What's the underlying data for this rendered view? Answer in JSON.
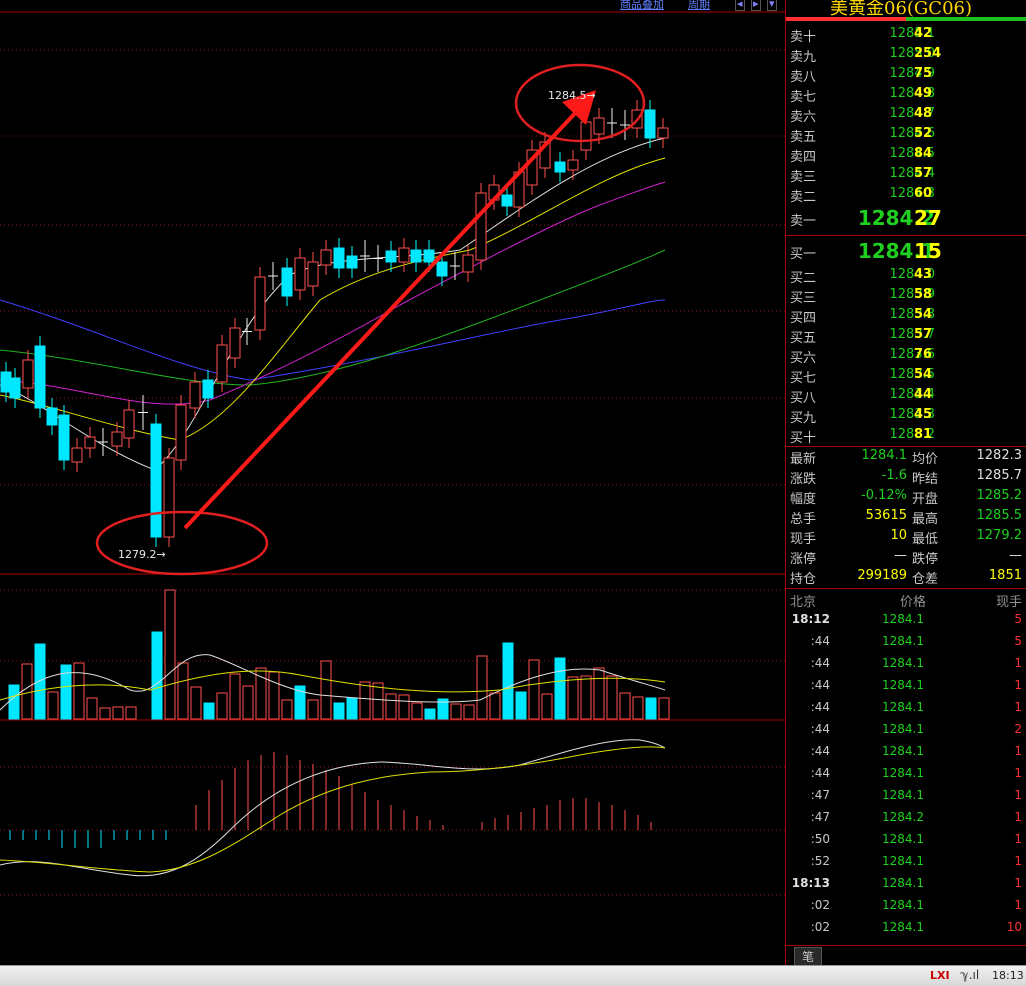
{
  "toolbar": {
    "link_overlay": "商品叠加",
    "link_cycle": "周期",
    "nav_prev": "◂",
    "nav_next": "▸",
    "nav_menu": "▾"
  },
  "chart": {
    "low_label": "1279.2→",
    "high_label": "1284.5→"
  },
  "panel": {
    "title": "美黄金06(GC06)",
    "sell": [
      {
        "label": "卖十",
        "price": "1285.1",
        "qty": "42"
      },
      {
        "label": "卖九",
        "price": "1285.0",
        "qty": "254"
      },
      {
        "label": "卖八",
        "price": "1284.9",
        "qty": "75"
      },
      {
        "label": "卖七",
        "price": "1284.8",
        "qty": "49"
      },
      {
        "label": "卖六",
        "price": "1284.7",
        "qty": "48"
      },
      {
        "label": "卖五",
        "price": "1284.6",
        "qty": "52"
      },
      {
        "label": "卖四",
        "price": "1284.5",
        "qty": "84"
      },
      {
        "label": "卖三",
        "price": "1284.4",
        "qty": "57"
      },
      {
        "label": "卖二",
        "price": "1284.3",
        "qty": "60"
      },
      {
        "label": "卖一",
        "price": "1284.2",
        "qty": "27"
      }
    ],
    "buy": [
      {
        "label": "买一",
        "price": "1284.1",
        "qty": "15"
      },
      {
        "label": "买二",
        "price": "1284.0",
        "qty": "43"
      },
      {
        "label": "买三",
        "price": "1283.9",
        "qty": "58"
      },
      {
        "label": "买四",
        "price": "1283.8",
        "qty": "54"
      },
      {
        "label": "买五",
        "price": "1283.7",
        "qty": "57"
      },
      {
        "label": "买六",
        "price": "1283.6",
        "qty": "76"
      },
      {
        "label": "买七",
        "price": "1283.5",
        "qty": "54"
      },
      {
        "label": "买八",
        "price": "1283.4",
        "qty": "44"
      },
      {
        "label": "买九",
        "price": "1283.3",
        "qty": "45"
      },
      {
        "label": "买十",
        "price": "1283.2",
        "qty": "81"
      }
    ],
    "quote": [
      {
        "k1": "最新",
        "v1": "1284.1",
        "c1": "g",
        "k2": "均价",
        "v2": "1282.3",
        "c2": "w"
      },
      {
        "k1": "涨跌",
        "v1": "-1.6",
        "c1": "g",
        "k2": "昨结",
        "v2": "1285.7",
        "c2": "w"
      },
      {
        "k1": "幅度",
        "v1": "-0.12%",
        "c1": "g",
        "k2": "开盘",
        "v2": "1285.2",
        "c2": "g"
      },
      {
        "k1": "总手",
        "v1": "53615",
        "c1": "y",
        "k2": "最高",
        "v2": "1285.5",
        "c2": "g"
      },
      {
        "k1": "现手",
        "v1": "10",
        "c1": "y",
        "k2": "最低",
        "v2": "1279.2",
        "c2": "g"
      },
      {
        "k1": "涨停",
        "v1": "—",
        "c1": "w",
        "k2": "跌停",
        "v2": "—",
        "c2": "w"
      },
      {
        "k1": "持仓",
        "v1": "299189",
        "c1": "y",
        "k2": "仓差",
        "v2": "1851",
        "c2": "y"
      }
    ],
    "ticks_header": {
      "time": "北京",
      "price": "价格",
      "vol": "现手"
    },
    "ticks": [
      {
        "time": "18:12",
        "price": "1284.1",
        "vol": "5"
      },
      {
        "time": ":44",
        "price": "1284.1",
        "vol": "5"
      },
      {
        "time": ":44",
        "price": "1284.1",
        "vol": "1"
      },
      {
        "time": ":44",
        "price": "1284.1",
        "vol": "1"
      },
      {
        "time": ":44",
        "price": "1284.1",
        "vol": "1"
      },
      {
        "time": ":44",
        "price": "1284.1",
        "vol": "2"
      },
      {
        "time": ":44",
        "price": "1284.1",
        "vol": "1"
      },
      {
        "time": ":44",
        "price": "1284.1",
        "vol": "1"
      },
      {
        "time": ":47",
        "price": "1284.1",
        "vol": "1"
      },
      {
        "time": ":47",
        "price": "1284.2",
        "vol": "1"
      },
      {
        "time": ":50",
        "price": "1284.1",
        "vol": "1"
      },
      {
        "time": ":52",
        "price": "1284.1",
        "vol": "1"
      },
      {
        "time": "18:13",
        "price": "1284.1",
        "vol": "1"
      },
      {
        "time": ":02",
        "price": "1284.1",
        "vol": "1"
      },
      {
        "time": ":02",
        "price": "1284.1",
        "vol": "10"
      }
    ],
    "tab_label": "笔"
  },
  "status": {
    "brand": "LXI",
    "signal": "ℽ.ıl",
    "clock": "18:13"
  }
}
